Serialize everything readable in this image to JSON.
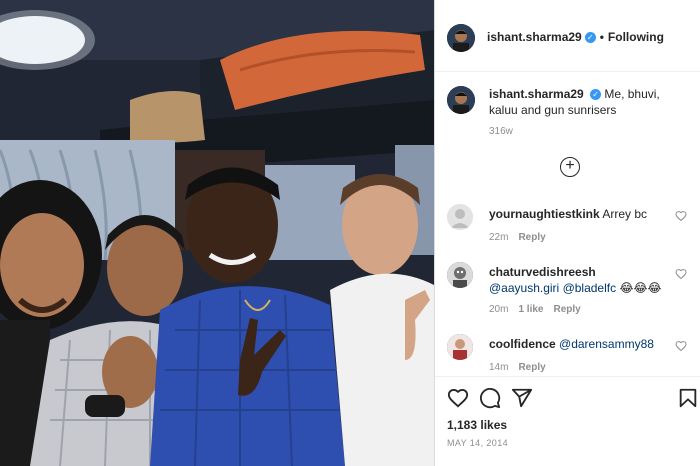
{
  "post": {
    "username": "ishant.sharma29",
    "separator": "•",
    "follow_label": "Following",
    "verified_mark": "✓",
    "caption_text": "Me, bhuvi, kaluu and gun sunrisers",
    "caption_time": "316w",
    "load_more_symbol": "+",
    "likes": "1,183 likes",
    "date": "MAY 14, 2014"
  },
  "comments": [
    {
      "username": "yournaughtiestkink",
      "text": "Arrey bc",
      "time": "22m",
      "likes": "",
      "reply_label": "Reply",
      "avatar_color": "#c7c7c7"
    },
    {
      "username": "chaturvedishreesh",
      "mention1": "@aayush.giri",
      "mention2": "@bladelfc",
      "emoji": "😂😂😂",
      "time": "20m",
      "likes": "1 like",
      "reply_label": "Reply",
      "avatar_color": "#d8d8d8"
    },
    {
      "username": "coolfidence",
      "mention1": "@darensammy88",
      "time": "14m",
      "likes": "",
      "reply_label": "Reply",
      "avatar_color": "#a83232"
    }
  ],
  "icons": {
    "heart": "heart-icon",
    "comment": "comment-icon",
    "share": "share-icon",
    "save": "bookmark-icon",
    "comment_like": "heart-outline-icon",
    "load_more": "plus-circle-icon"
  },
  "colors": {
    "link": "#00376b",
    "muted": "#8e8e8e",
    "verified": "#3897f0",
    "shirt_blue": "#2f4fb0"
  }
}
